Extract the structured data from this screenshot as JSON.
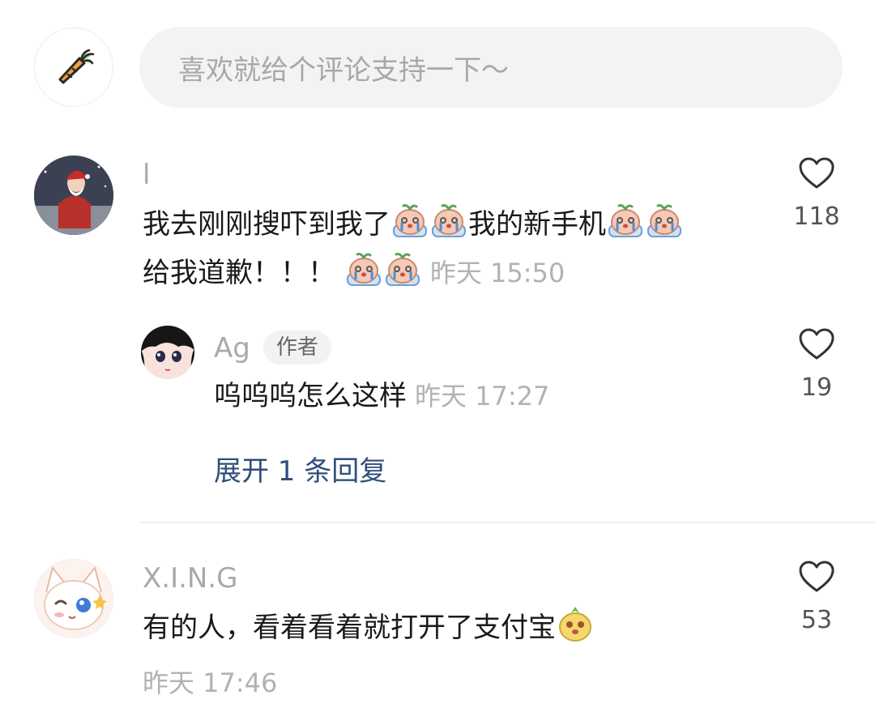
{
  "composer": {
    "placeholder": "喜欢就给个评论支持一下～",
    "avatar_icon": "carrot-icon"
  },
  "comments": [
    {
      "username": "l",
      "avatar": "santa-avatar",
      "text_parts": [
        "我去刚刚搜吓到我了",
        "我的新手机",
        "给我道歉！！！"
      ],
      "emoji": "crying-carrot-emoji",
      "time": "昨天 15:50",
      "likes": "118",
      "reply": {
        "username": "Ag",
        "badge": "作者",
        "avatar": "anime-girl-avatar",
        "text": "呜呜呜怎么这样",
        "time": "昨天 17:27",
        "likes": "19"
      },
      "expand_label": "展开 1 条回复"
    },
    {
      "username": "X.I.N.G",
      "avatar": "cat-avatar",
      "text": "有的人，看着看着就打开了支付宝",
      "emoji": "pineapple-emoji",
      "time": "昨天 17:46",
      "likes": "53"
    }
  ],
  "colors": {
    "accent_link": "#2f4e7a",
    "muted_text": "#a9a9a9",
    "input_bg": "#f3f3f3"
  }
}
